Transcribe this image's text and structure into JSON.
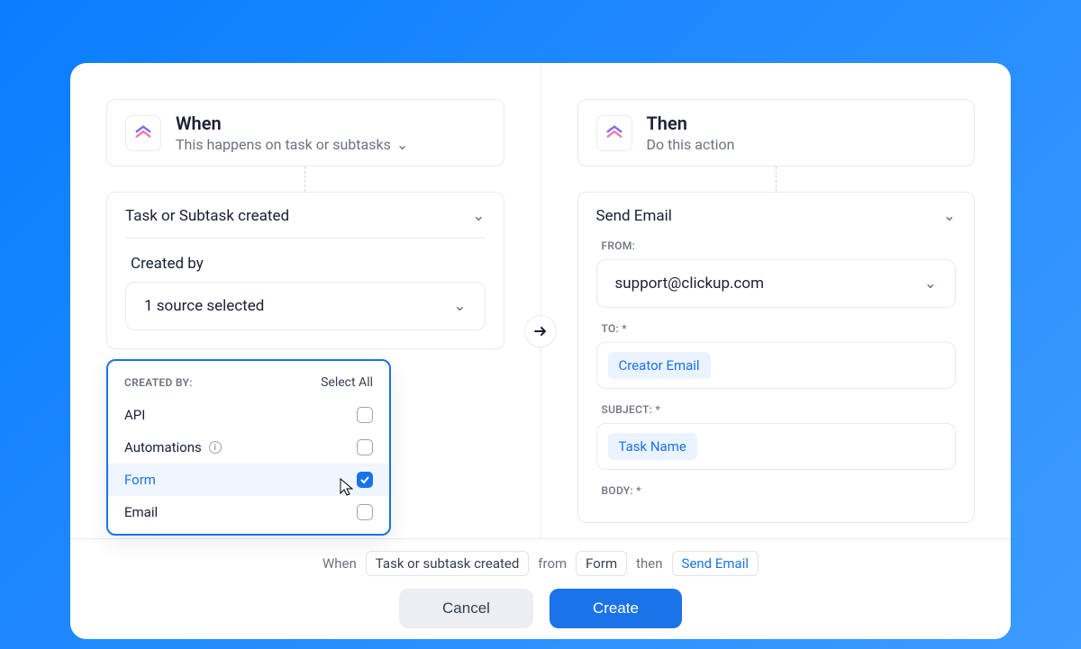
{
  "when": {
    "title": "When",
    "subtitle": "This happens on task or subtasks",
    "trigger": "Task or Subtask created",
    "createdByLabel": "Created by",
    "sourceSelected": "1 source selected"
  },
  "dropdown": {
    "header": "CREATED BY:",
    "selectAll": "Select All",
    "items": [
      {
        "label": "API",
        "checked": false,
        "info": false
      },
      {
        "label": "Automations",
        "checked": false,
        "info": true
      },
      {
        "label": "Form",
        "checked": true,
        "info": false
      },
      {
        "label": "Email",
        "checked": false,
        "info": false
      }
    ]
  },
  "then": {
    "title": "Then",
    "subtitle": "Do this action",
    "action": "Send Email",
    "fromLabel": "FROM:",
    "fromValue": "support@clickup.com",
    "toLabel": "TO: *",
    "toTag": "Creator Email",
    "subjectLabel": "SUBJECT: *",
    "subjectTag": "Task Name",
    "bodyLabel": "BODY: *"
  },
  "summary": {
    "when": "When",
    "trigger": "Task or subtask created",
    "from": "from",
    "source": "Form",
    "then": "then",
    "action": "Send Email"
  },
  "buttons": {
    "cancel": "Cancel",
    "create": "Create"
  }
}
